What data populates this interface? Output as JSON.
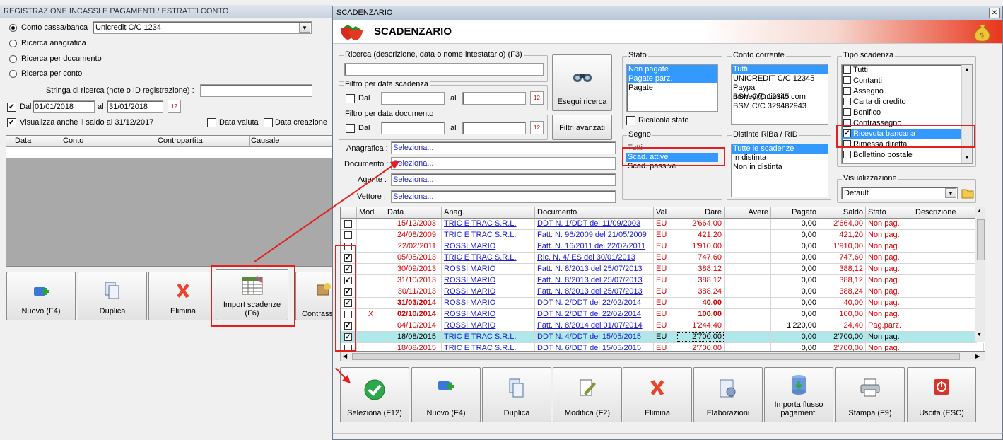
{
  "left": {
    "title": "REGISTRAZIONE INCASSI E PAGAMENTI / ESTRATTI CONTO",
    "radios": [
      "Conto cassa/banca",
      "Ricerca anagrafica",
      "Ricerca per documento",
      "Ricerca per conto"
    ],
    "conto_value": "Unicredit C/C 1234",
    "search_label": "Stringa di ricerca (note o ID registrazione) :",
    "dal_label": "Dal",
    "dal_value": "01/01/2018",
    "al_label": "al",
    "al_value": "31/01/2018",
    "saldo_label": "Visualizza anche il saldo al 31/12/2017",
    "data_valuta": "Data valuta",
    "data_creazione": "Data creazione",
    "columns": [
      "Data",
      "Conto",
      "Contropartita",
      "Causale"
    ],
    "buttons": {
      "nuovo": "Nuovo (F4)",
      "duplica": "Duplica",
      "elimina": "Elimina",
      "import1": "Import scadenze",
      "import2": "(F6)",
      "contrass": "Contrass"
    }
  },
  "dialog": {
    "title": "SCADENZARIO",
    "heading": "SCADENZARIO",
    "close": "✕",
    "ricerca_label": "Ricerca (descrizione, data o nome intestatario) (F3)",
    "filtro_scad": "Filtro per data scadenza",
    "filtro_doc": "Filtro per data documento",
    "dal": "Dal",
    "al": "al",
    "cal_day": "12",
    "btn_esegui": "Esegui ricerca",
    "btn_filtri": "Filtri avanzati",
    "anagrafica_label": "Anagrafica :",
    "documento_label": "Documento :",
    "agente_label": "Agente :",
    "vettore_label": "Vettore :",
    "seleziona": "Seleziona...",
    "stato": {
      "label": "Stato",
      "items": [
        "Non pagate",
        "Pagate parz.",
        "Pagate"
      ],
      "ricalcola": "Ricalcola stato"
    },
    "segno": {
      "label": "Segno",
      "items": [
        "Tutti",
        "Scad. attive",
        "Scad. passive"
      ]
    },
    "conto": {
      "label": "Conto corrente",
      "items": [
        "Tutti",
        "UNICREDIT C/C 12345",
        "Paypal money@miosito.com",
        "BSM C/C 12345",
        "BSM C/C 329482943"
      ]
    },
    "distinte": {
      "label": "Distinte RiBa / RID",
      "items": [
        "Tutte le scadenze",
        "In distinta",
        "Non in distinta"
      ]
    },
    "tipo": {
      "label": "Tipo scadenza",
      "items": [
        "Tutti",
        "Contanti",
        "Assegno",
        "Carta di credito",
        "Bonifico",
        "Contrassegno",
        "Ricevuta bancaria",
        "Rimessa diretta",
        "Bollettino postale"
      ]
    },
    "visual": {
      "label": "Visualizzazione",
      "value": "Default"
    },
    "grid": {
      "columns": [
        "",
        "Mod",
        "Data",
        "Anag.",
        "Documento",
        "Val",
        "Dare",
        "Avere",
        "Pagato",
        "Saldo",
        "Stato",
        "Descrizione"
      ],
      "rows": [
        {
          "chk": false,
          "mod": "",
          "data": "15/12/2003",
          "anag": "TRIC E TRAC S.R.L.",
          "doc": "DDT N. 1/DDT del 11/09/2003",
          "val": "EU",
          "dare": "2'664,00",
          "avere": "",
          "pagato": "0,00",
          "saldo": "2'664,00",
          "stato": "Non pag.",
          "bold": false,
          "sel": false
        },
        {
          "chk": false,
          "mod": "",
          "data": "24/08/2009",
          "anag": "TRIC E TRAC S.R.L.",
          "doc": "Fatt. N. 96/2009 del 21/05/2009",
          "val": "EU",
          "dare": "421,20",
          "avere": "",
          "pagato": "0,00",
          "saldo": "421,20",
          "stato": "Non pag.",
          "bold": false,
          "sel": false
        },
        {
          "chk": false,
          "mod": "",
          "data": "22/02/2011",
          "anag": "ROSSI MARIO",
          "doc": "Fatt. N. 16/2011 del 22/02/2011",
          "val": "EU",
          "dare": "1'910,00",
          "avere": "",
          "pagato": "0,00",
          "saldo": "1'910,00",
          "stato": "Non pag.",
          "bold": false,
          "sel": false
        },
        {
          "chk": true,
          "mod": "",
          "data": "05/05/2013",
          "anag": "TRIC E TRAC S.R.L.",
          "doc": "Ric. N. 4/ ES del 30/01/2013",
          "val": "EU",
          "dare": "747,60",
          "avere": "",
          "pagato": "0,00",
          "saldo": "747,60",
          "stato": "Non pag.",
          "bold": false,
          "sel": false
        },
        {
          "chk": true,
          "mod": "",
          "data": "30/09/2013",
          "anag": "ROSSI MARIO",
          "doc": "Fatt. N. 8/2013 del 25/07/2013",
          "val": "EU",
          "dare": "388,12",
          "avere": "",
          "pagato": "0,00",
          "saldo": "388,12",
          "stato": "Non pag.",
          "bold": false,
          "sel": false
        },
        {
          "chk": true,
          "mod": "",
          "data": "31/10/2013",
          "anag": "ROSSI MARIO",
          "doc": "Fatt. N. 8/2013 del 25/07/2013",
          "val": "EU",
          "dare": "388,12",
          "avere": "",
          "pagato": "0,00",
          "saldo": "388,12",
          "stato": "Non pag.",
          "bold": false,
          "sel": false
        },
        {
          "chk": true,
          "mod": "",
          "data": "30/11/2013",
          "anag": "ROSSI MARIO",
          "doc": "Fatt. N. 8/2013 del 25/07/2013",
          "val": "EU",
          "dare": "388,24",
          "avere": "",
          "pagato": "0,00",
          "saldo": "388,24",
          "stato": "Non pag.",
          "bold": false,
          "sel": false
        },
        {
          "chk": true,
          "mod": "",
          "data": "31/03/2014",
          "anag": "ROSSI MARIO",
          "doc": "DDT N. 2/DDT del 22/02/2014",
          "val": "EU",
          "dare": "40,00",
          "avere": "",
          "pagato": "0,00",
          "saldo": "40,00",
          "stato": "Non pag.",
          "bold": true,
          "sel": false
        },
        {
          "chk": false,
          "mod": "X",
          "data": "02/10/2014",
          "anag": "ROSSI MARIO",
          "doc": "DDT N. 2/DDT del 22/02/2014",
          "val": "EU",
          "dare": "100,00",
          "avere": "",
          "pagato": "0,00",
          "saldo": "100,00",
          "stato": "Non pag.",
          "bold": true,
          "sel": false
        },
        {
          "chk": true,
          "mod": "",
          "data": "04/10/2014",
          "anag": "ROSSI MARIO",
          "doc": "Fatt. N. 8/2014 del 01/07/2014",
          "val": "EU",
          "dare": "1'244,40",
          "avere": "",
          "pagato": "1'220,00",
          "saldo": "24,40",
          "stato": "Pag.parz.",
          "bold": false,
          "sel": false
        },
        {
          "chk": true,
          "mod": "",
          "data": "18/08/2015",
          "anag": "TRIC E TRAC S.R.L.",
          "doc": "DDT N. 4/DDT del 15/05/2015",
          "val": "EU",
          "dare": "2'700,00",
          "avere": "",
          "pagato": "0,00",
          "saldo": "2'700,00",
          "stato": "Non pag.",
          "bold": false,
          "sel": true
        },
        {
          "chk": false,
          "mod": "",
          "data": "18/08/2015",
          "anag": "TRIC E TRAC S.R.L.",
          "doc": "DDT N. 6/DDT del 15/05/2015",
          "val": "EU",
          "dare": "2'700,00",
          "avere": "",
          "pagato": "0,00",
          "saldo": "2'700,00",
          "stato": "Non pag.",
          "bold": false,
          "sel": false
        }
      ]
    },
    "buttons": [
      {
        "label": "Seleziona (F12)",
        "icon": "check-icon"
      },
      {
        "label": "Nuovo (F4)",
        "icon": "new-icon"
      },
      {
        "label": "Duplica",
        "icon": "duplicate-icon"
      },
      {
        "label": "Modifica (F2)",
        "icon": "edit-icon"
      },
      {
        "label": "Elimina",
        "icon": "delete-icon"
      },
      {
        "label": "Elaborazioni",
        "icon": "process-icon"
      },
      {
        "label": "Importa flusso\npagamenti",
        "icon": "import-icon"
      },
      {
        "label": "Stampa (F9)",
        "icon": "print-icon"
      },
      {
        "label": "Uscita (ESC)",
        "icon": "exit-icon"
      }
    ],
    "colors": {
      "accent": "#3399ff",
      "red": "#d90000",
      "link": "#1a1ad6",
      "highlight": "#aee8ea",
      "annotation": "#e32020"
    }
  }
}
